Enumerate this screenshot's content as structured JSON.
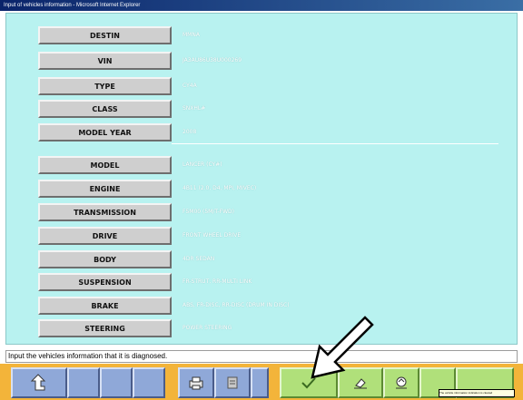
{
  "window": {
    "title": "Input of vehicles information - Microsoft Internet Explorer"
  },
  "fields_top": [
    {
      "label": "DESTIN",
      "value": "MMNA"
    },
    {
      "label": "VIN",
      "value": "JA3AU86U38U000269"
    },
    {
      "label": "TYPE",
      "value": "CY4A"
    },
    {
      "label": "CLASS",
      "value": "SNXHL#"
    },
    {
      "label": "MODEL YEAR",
      "value": "2008"
    }
  ],
  "fields_bottom": [
    {
      "label": "MODEL",
      "value": "LANCER (CY#)"
    },
    {
      "label": "ENGINE",
      "value": "4B11 (2.0, D4, MPI, MIVEC)"
    },
    {
      "label": "TRANSMISSION",
      "value": "F5M00 (5M/T-FWD)"
    },
    {
      "label": "DRIVE",
      "value": "FRONT WHEEL DRIVE"
    },
    {
      "label": "BODY",
      "value": "4DR SEDAN"
    },
    {
      "label": "SUSPENSION",
      "value": "FR-STRUT, RR-MULTI LINK"
    },
    {
      "label": "BRAKE",
      "value": "ABS, FR-DISC, RR-DISC (DRUM IN DISC)"
    },
    {
      "label": "STEERING",
      "value": "POWER STEERING"
    }
  ],
  "status": {
    "text": "Input the vehicles information that it is diagnosed."
  },
  "toolbar": {
    "tooltip": "The vehicle information indication is cleared"
  },
  "icons": {
    "back": "return-arrow-icon",
    "print": "printer-icon",
    "memo": "notepad-icon",
    "ok": "checkmark-icon",
    "erase": "eraser-icon",
    "clear": "clear-info-icon"
  },
  "colors": {
    "panel": "#b8f2f0",
    "toolbar": "#f3b43a",
    "button_blue": "#8fa8d8",
    "button_green": "#b0e07a"
  }
}
